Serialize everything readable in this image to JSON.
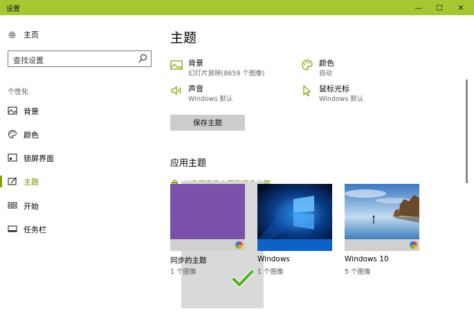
{
  "window": {
    "title": "设置",
    "minimize": "—",
    "maximize": "☐",
    "close": "✕"
  },
  "sidebar": {
    "home_label": "主页",
    "search_placeholder": "查找设置",
    "section_label": "个性化",
    "items": [
      {
        "label": "背景",
        "icon": "picture-icon"
      },
      {
        "label": "颜色",
        "icon": "palette-icon"
      },
      {
        "label": "锁屏界面",
        "icon": "lock-screen-icon"
      },
      {
        "label": "主题",
        "icon": "theme-icon",
        "active": true
      },
      {
        "label": "开始",
        "icon": "start-icon"
      },
      {
        "label": "任务栏",
        "icon": "taskbar-icon"
      }
    ]
  },
  "main": {
    "title": "主题",
    "properties": [
      {
        "name": "背景",
        "value": "幻灯片放映(8659 个图像)",
        "icon": "picture-icon"
      },
      {
        "name": "颜色",
        "value": "自动",
        "icon": "palette-icon"
      },
      {
        "name": "声音",
        "value": "Windows 默认",
        "icon": "speaker-icon"
      },
      {
        "name": "鼠标光标",
        "value": "Windows 默认",
        "icon": "cursor-icon"
      }
    ],
    "save_button": "保存主题",
    "apply_heading": "应用主题",
    "store_link": "从应用商店中获取更多主题",
    "themes": [
      {
        "name": "同步的主题",
        "count": "1 个图像"
      },
      {
        "name": "Windows",
        "count": "1 个图像"
      },
      {
        "name": "Windows 10",
        "count": "5 个图像",
        "selected": true
      }
    ]
  },
  "colors": {
    "accent": "#a5c832",
    "accent_text": "#6e9400"
  }
}
